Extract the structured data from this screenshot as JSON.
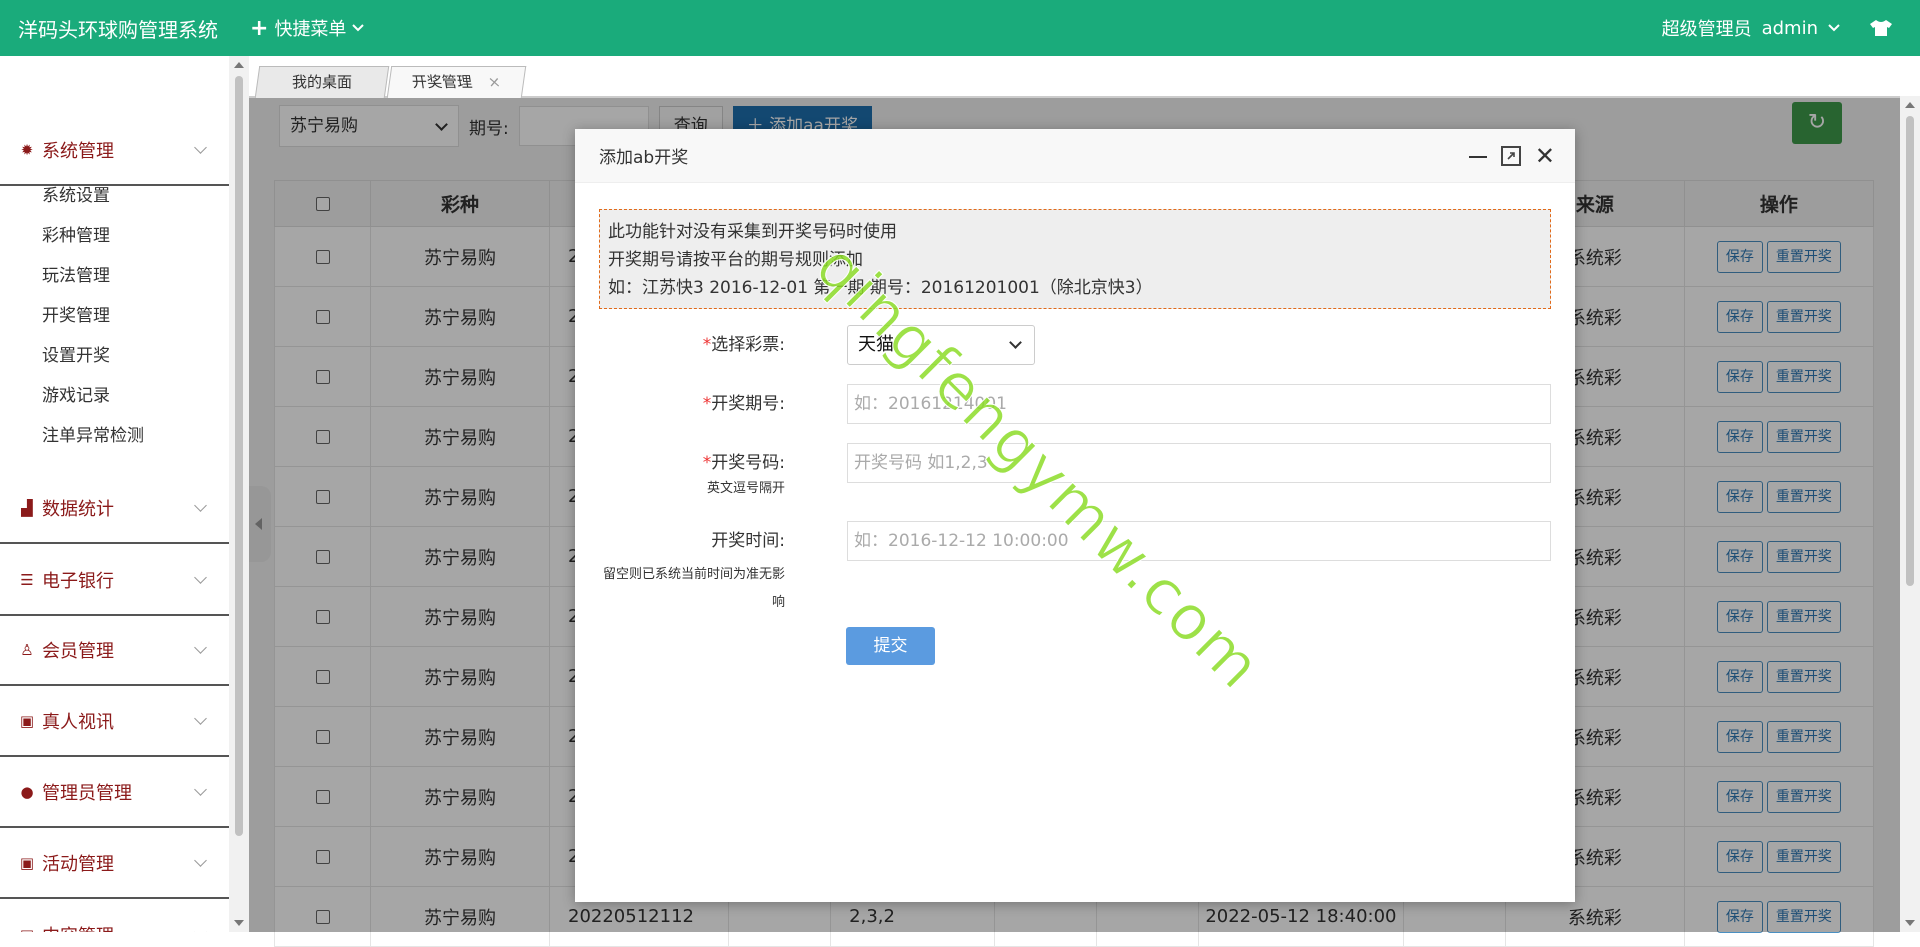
{
  "topbar": {
    "brand": "洋码头环球购管理系统",
    "quick_menu": "快捷菜单",
    "role": "超级管理员",
    "user": "admin"
  },
  "sidebar": {
    "groups": [
      {
        "label": "系统管理",
        "icon": "gear-icon"
      },
      {
        "label": "数据统计",
        "icon": "chart-icon"
      },
      {
        "label": "电子银行",
        "icon": "list-icon"
      },
      {
        "label": "会员管理",
        "icon": "user-icon"
      },
      {
        "label": "真人视讯",
        "icon": "gift-icon"
      },
      {
        "label": "管理员管理",
        "icon": "person-icon"
      },
      {
        "label": "活动管理",
        "icon": "gift-icon"
      },
      {
        "label": "内容管理",
        "icon": "book-icon"
      }
    ],
    "sub_items": [
      "系统设置",
      "彩种管理",
      "玩法管理",
      "开奖管理",
      "设置开奖",
      "游戏记录",
      "注单异常检测"
    ]
  },
  "tabs": [
    {
      "label": "我的桌面"
    },
    {
      "label": "开奖管理",
      "close": "×"
    }
  ],
  "toolbar": {
    "select_value": "苏宁易购",
    "period_label": "期号:",
    "query_button": "查询",
    "add_button": "添加aa开奖"
  },
  "table": {
    "headers": [
      "彩种",
      "来源",
      "操作"
    ],
    "rows": [
      {
        "lottery": "苏宁易购",
        "period": "2",
        "source": "系统彩"
      },
      {
        "lottery": "苏宁易购",
        "period": "2",
        "source": "系统彩"
      },
      {
        "lottery": "苏宁易购",
        "period": "2",
        "source": "系统彩"
      },
      {
        "lottery": "苏宁易购",
        "period": "2",
        "source": "系统彩"
      },
      {
        "lottery": "苏宁易购",
        "period": "2",
        "source": "系统彩"
      },
      {
        "lottery": "苏宁易购",
        "period": "2",
        "source": "系统彩"
      },
      {
        "lottery": "苏宁易购",
        "period": "2",
        "source": "系统彩"
      },
      {
        "lottery": "苏宁易购",
        "period": "2",
        "source": "系统彩"
      },
      {
        "lottery": "苏宁易购",
        "period": "2",
        "source": "系统彩"
      },
      {
        "lottery": "苏宁易购",
        "period": "2",
        "source": "系统彩"
      },
      {
        "lottery": "苏宁易购",
        "period": "2",
        "source": "系统彩"
      },
      {
        "lottery": "苏宁易购",
        "period": "20220512112",
        "numbers": "2,3,2",
        "time": "2022-05-12 18:40:00",
        "source": "系统彩"
      }
    ],
    "save_label": "保存",
    "reset_label": "重置开奖"
  },
  "modal": {
    "title": "添加ab开奖",
    "notice": [
      "此功能针对没有采集到开奖号码时使用",
      "开奖期号请按平台的期号规则添加",
      "如：江苏快3 2016-12-01 第一期 期号：20161201001（除北京快3）"
    ],
    "fields": {
      "lottery_label": "选择彩票:",
      "lottery_value": "天猫",
      "period_label": "开奖期号:",
      "period_placeholder": "如：20161214001",
      "numbers_label": "开奖号码:",
      "numbers_hint": "英文逗号隔开",
      "numbers_placeholder": "开奖号码 如1,2,3",
      "time_label": "开奖时间:",
      "time_hint": "留空则已系统当前时间为准无影响",
      "time_placeholder": "如：2016-12-12 10:00:00"
    },
    "submit": "提交"
  },
  "watermark": "qingfengymw.com",
  "colors": {
    "topbar": "#1aab7b",
    "menu_text": "#8b1a1a",
    "submit": "#5b9be0",
    "notice_border": "#e06a1a"
  }
}
